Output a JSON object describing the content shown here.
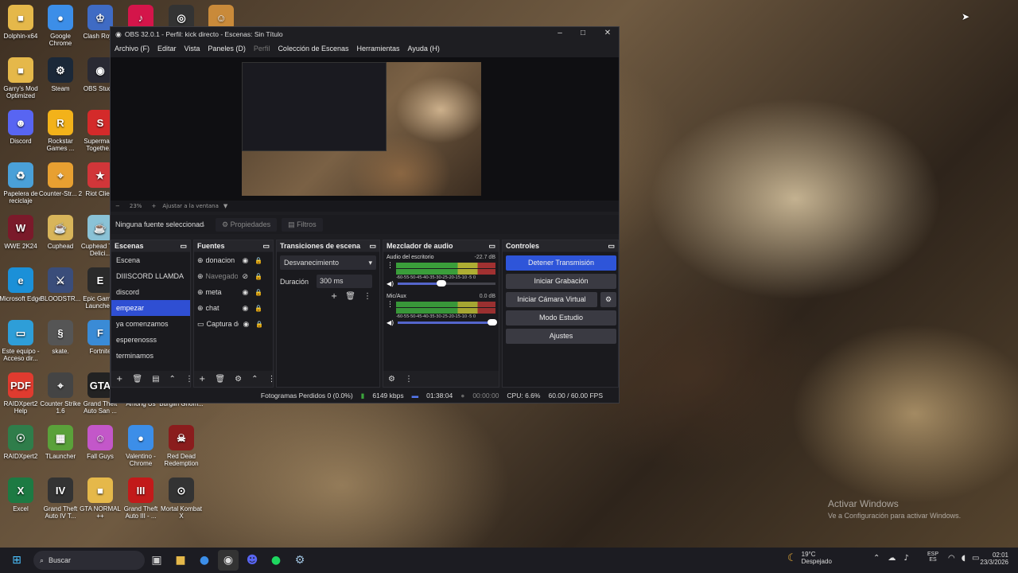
{
  "desktop_icons": [
    {
      "label": "Dolphin-x64",
      "glyph": "■",
      "color": "#e5b84a"
    },
    {
      "label": "Google Chrome",
      "glyph": "●",
      "color": "#3c8ee8"
    },
    {
      "label": "Clash Roy...",
      "glyph": "♔",
      "color": "#3f6bc4"
    },
    {
      "label": "",
      "glyph": "♪",
      "color": "#d4154a"
    },
    {
      "label": "",
      "glyph": "◎",
      "color": "#333"
    },
    {
      "label": "",
      "glyph": "☺",
      "color": "#c98a3a"
    },
    {
      "label": "Garry's Mod Optimized",
      "glyph": "■",
      "color": "#e5b84a"
    },
    {
      "label": "Steam",
      "glyph": "⚙",
      "color": "#1b2838"
    },
    {
      "label": "OBS Stud...",
      "glyph": "◉",
      "color": "#2a2a33"
    },
    {
      "label": "Discord",
      "glyph": "☻",
      "color": "#5865f2"
    },
    {
      "label": "Rockstar Games ...",
      "glyph": "R",
      "color": "#f3b21a"
    },
    {
      "label": "Supermar... Togethe...",
      "glyph": "S",
      "color": "#d42a2a"
    },
    {
      "label": "Papelera de reciclaje",
      "glyph": "♻",
      "color": "#4aa0d8"
    },
    {
      "label": "Counter-Str... 2",
      "glyph": "⌖",
      "color": "#e8a031"
    },
    {
      "label": "Riot Clie...",
      "glyph": "★",
      "color": "#d13639"
    },
    {
      "label": "WWE 2K24",
      "glyph": "W",
      "color": "#7a1a2a"
    },
    {
      "label": "Cuphead",
      "glyph": "☕",
      "color": "#d8b55a"
    },
    {
      "label": "Cuphead The Delici...",
      "glyph": "☕",
      "color": "#8ac2d6"
    },
    {
      "label": "Microsoft Edge",
      "glyph": "e",
      "color": "#1b90d8"
    },
    {
      "label": "BLOODSTR...",
      "glyph": "⚔",
      "color": "#3a4d7a"
    },
    {
      "label": "Epic Games Launche...",
      "glyph": "E",
      "color": "#2a2a2a"
    },
    {
      "label": "Este equipo - Acceso dir...",
      "glyph": "▭",
      "color": "#2e9ed8"
    },
    {
      "label": "skate.",
      "glyph": "§",
      "color": "#555"
    },
    {
      "label": "Fortnite",
      "glyph": "F",
      "color": "#3a8bd6"
    },
    {
      "label": "RAIDXpert2 Help",
      "glyph": "PDF",
      "color": "#e03b2f"
    },
    {
      "label": "Counter Strike 1.6",
      "glyph": "⌖",
      "color": "#444"
    },
    {
      "label": "Grand Theft Auto San ...",
      "glyph": "GTA",
      "color": "#222"
    },
    {
      "label": "Among Us",
      "glyph": "◘",
      "color": "transparent"
    },
    {
      "label": "Burglin Gnom...",
      "glyph": "◘",
      "color": "transparent"
    },
    {
      "label": "RAIDXpert2",
      "glyph": "☉",
      "color": "#2f7d4a"
    },
    {
      "label": "TLauncher",
      "glyph": "▦",
      "color": "#5aa13a"
    },
    {
      "label": "Fall Guys",
      "glyph": "☺",
      "color": "#c357c9"
    },
    {
      "label": "Valentino - Chrome",
      "glyph": "●",
      "color": "#3c8ee8"
    },
    {
      "label": "Red Dead Redemption",
      "glyph": "☠",
      "color": "#8a1d1d"
    },
    {
      "label": "Excel",
      "glyph": "X",
      "color": "#1d7a43"
    },
    {
      "label": "Grand Theft Auto IV T...",
      "glyph": "IV",
      "color": "#333"
    },
    {
      "label": "GTA NORMAL ++",
      "glyph": "■",
      "color": "#e5b84a"
    },
    {
      "label": "Grand Theft Auto III - ...",
      "glyph": "III",
      "color": "#c21a1a"
    },
    {
      "label": "Mortal Kombat X",
      "glyph": "⊙",
      "color": "#333"
    }
  ],
  "obs": {
    "title": "OBS 32.0.1 - Perfil: kick directo - Escenas: Sin Título",
    "menu": [
      "Archivo (F)",
      "Editar",
      "Vista",
      "Paneles (D)",
      "Perfil",
      "Colección de Escenas",
      "Herramientas",
      "Ayuda (H)"
    ],
    "zoom": {
      "percent": "23%",
      "fit": "Ajustar a la ventana"
    },
    "source_bar": {
      "none": "Ninguna fuente seleccionada",
      "properties": "Propiedades",
      "filters": "Filtros"
    },
    "scenes": {
      "title": "Escenas",
      "items": [
        "Escena",
        "DIIISCORD LLAMDA",
        "discord",
        "empezar",
        "ya comenzamos",
        "esperenosss",
        "terminamos"
      ],
      "selected": "empezar"
    },
    "sources": {
      "title": "Fuentes",
      "items": [
        {
          "name": "donacion",
          "type": "web"
        },
        {
          "name": "Navegador",
          "type": "web",
          "hidden": true
        },
        {
          "name": "meta",
          "type": "web"
        },
        {
          "name": "chat",
          "type": "web"
        },
        {
          "name": "Captura de",
          "type": "capture"
        }
      ]
    },
    "transitions": {
      "title": "Transiciones de escena",
      "type": "Desvanecimiento",
      "duration_label": "Duración",
      "duration": "300 ms"
    },
    "mixer": {
      "title": "Mezclador de audio",
      "channels": [
        {
          "name": "Audio del escritorio",
          "db": "-22.7 dB",
          "level": 0.55,
          "volume": 0.45
        },
        {
          "name": "Mic/Aux",
          "db": "0.0 dB",
          "level": 0.5,
          "volume": 0.97
        }
      ],
      "scale": "-60-55-50-45-40-35-30-25-20-15-10 -5 0"
    },
    "controls": {
      "title": "Controles",
      "stop_stream": "Detener Transmisión",
      "start_rec": "Iniciar Grabación",
      "virtual_cam": "Iniciar Cámara Virtual",
      "studio": "Modo Estudio",
      "settings": "Ajustes"
    },
    "status": {
      "dropped": "Fotogramas Perdidos 0 (0.0%)",
      "bitrate": "6149 kbps",
      "stream_time": "01:38:04",
      "rec_time": "00:00:00",
      "cpu": "CPU: 6.6%",
      "fps": "60.00 / 60.00 FPS"
    }
  },
  "taskbar": {
    "search": "Buscar",
    "weather_temp": "19°C",
    "weather_text": "Despejado",
    "lang1": "ESP",
    "lang2": "ES",
    "time": "02:01",
    "date": "23/3/2026"
  },
  "watermark": {
    "line1": "Activar Windows",
    "line2": "Ve a Configuración para activar Windows."
  }
}
